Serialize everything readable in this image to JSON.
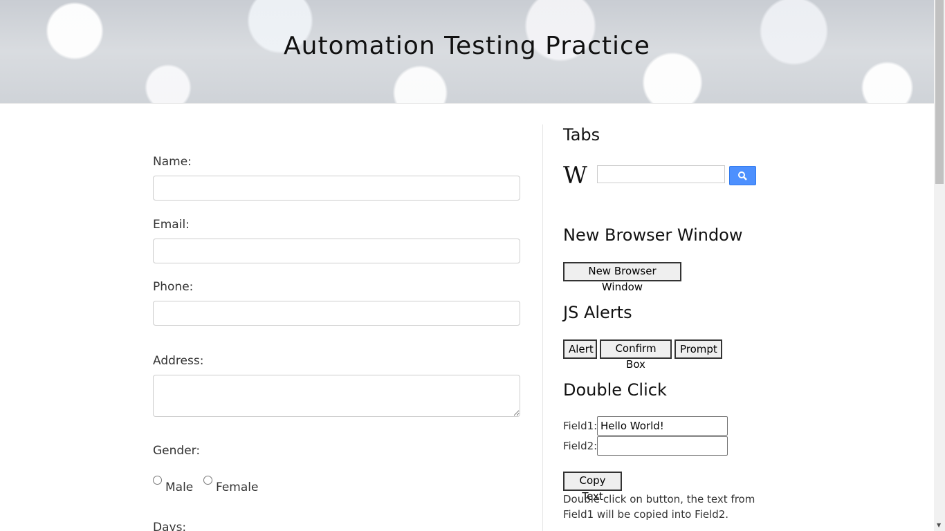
{
  "header": {
    "title": "Automation Testing Practice"
  },
  "form": {
    "name_label": "Name:",
    "email_label": "Email:",
    "phone_label": "Phone:",
    "address_label": "Address:",
    "gender_label": "Gender:",
    "gender_options": [
      "Male",
      "Female"
    ],
    "days_label": "Days:"
  },
  "tabs": {
    "title": "Tabs",
    "logo_text": "W",
    "search_value": ""
  },
  "new_window": {
    "title": "New Browser Window",
    "button_label": "New Browser Window"
  },
  "alerts": {
    "title": "JS Alerts",
    "buttons": [
      "Alert",
      "Confirm Box",
      "Prompt"
    ]
  },
  "double_click": {
    "title": "Double Click",
    "field1_label": "Field1:",
    "field1_value": "Hello World!",
    "field2_label": "Field2:",
    "field2_value": "",
    "button_label": "Copy Text",
    "note": "Double click on button, the text from Field1 will be copied into Field2."
  },
  "colors": {
    "search_button": "#4d90fe"
  }
}
